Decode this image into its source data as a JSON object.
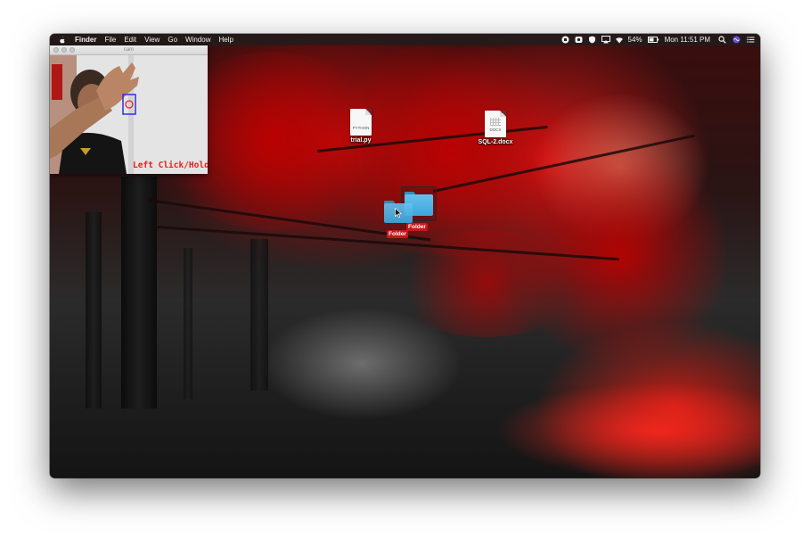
{
  "menubar": {
    "apple_icon": "apple-logo-icon",
    "app_name": "Finder",
    "menus": [
      "File",
      "Edit",
      "View",
      "Go",
      "Window",
      "Help"
    ],
    "status": {
      "battery": "54%",
      "clock": "Mon 11:51 PM"
    }
  },
  "camera_window": {
    "title": "cam",
    "overlay_label": "Left Click/Hold",
    "overlay_color": "#e8201a"
  },
  "desktop": {
    "files": [
      {
        "name": "trial.py",
        "kind_tag": "PYTHON"
      },
      {
        "name": "SQL-2.docx",
        "kind_tag": "DOCX"
      }
    ],
    "folders": [
      {
        "name": "Folder"
      },
      {
        "name": "Folder"
      }
    ]
  },
  "colors": {
    "menubar_bg": "#1e1e1e",
    "folder_blue": "#3fa6dc",
    "label_red": "#c41818"
  }
}
